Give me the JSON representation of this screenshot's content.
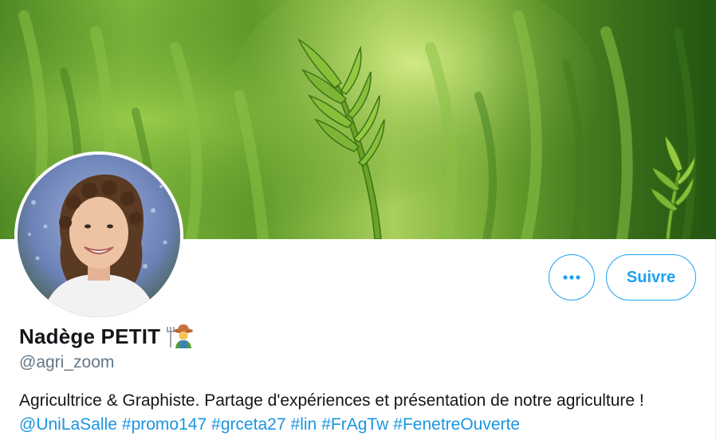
{
  "profile": {
    "display_name": "Nadège PETIT",
    "name_emoji": "farmer-emoji",
    "handle": "@agri_zoom",
    "bio_text": "Agricultrice & Graphiste. Partage d'expériences et présentation de notre agriculture !",
    "bio_links": [
      "@UniLaSalle",
      "#promo147",
      "#grceta27",
      "#lin",
      "#FrAgTw",
      "#FenetreOuverte"
    ]
  },
  "actions": {
    "more_icon": "more-horizontal-icon",
    "follow_label": "Suivre"
  },
  "colors": {
    "accent": "#1da1f2",
    "link": "#1b95e0",
    "text": "#14171a",
    "muted": "#657786"
  }
}
